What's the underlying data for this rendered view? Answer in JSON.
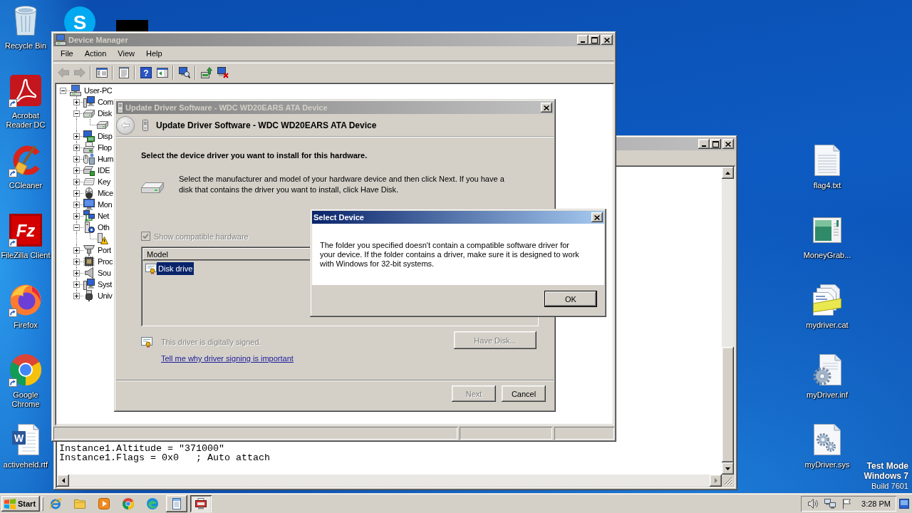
{
  "desktop": {
    "left_icons": [
      {
        "kind": "recycle-bin",
        "label": "Recycle Bin",
        "shortcut": false
      },
      {
        "kind": "pdf-reader",
        "label": "Acrobat Reader DC",
        "shortcut": true
      },
      {
        "kind": "cleaner",
        "label": "CCleaner",
        "shortcut": true
      },
      {
        "kind": "ftp-client",
        "label": "FileZilla Client",
        "shortcut": true,
        "logo_text": "Fz"
      },
      {
        "kind": "fox-browser",
        "label": "Firefox",
        "shortcut": true
      },
      {
        "kind": "chrome-browser",
        "label": "Google Chrome",
        "shortcut": true
      },
      {
        "kind": "word-document",
        "label": "activeheld.rtf",
        "shortcut": false,
        "logo_text": "W"
      }
    ],
    "covered_icon": {
      "kind": "chat-app",
      "logo_text": "S"
    },
    "right_icons": [
      {
        "kind": "text-file",
        "label": "flag4.txt",
        "shortcut": false
      },
      {
        "kind": "window-file",
        "label": "MoneyGrab...",
        "shortcut": false
      },
      {
        "kind": "catalog-file",
        "label": "mydriver.cat",
        "shortcut": false
      },
      {
        "kind": "settings-file",
        "label": "myDriver.inf",
        "shortcut": false
      },
      {
        "kind": "system-file",
        "label": "myDriver.sys",
        "shortcut": false
      }
    ],
    "test_mode": [
      "Test Mode",
      "Windows 7",
      "Build 7601"
    ]
  },
  "editor_window": {
    "active": false,
    "lines": [
      "Instance1.Altitude = \"371000\"",
      "Instance1.Flags = 0x0   ; Auto attach"
    ]
  },
  "device_manager": {
    "title": "Device Manager",
    "active": false,
    "menu": [
      "File",
      "Action",
      "View",
      "Help"
    ],
    "toolbar": [
      {
        "kind": "back",
        "disabled": true
      },
      {
        "kind": "forward",
        "disabled": true
      },
      {
        "kind": "separator"
      },
      {
        "kind": "console-tree",
        "disabled": false
      },
      {
        "kind": "separator"
      },
      {
        "kind": "properties",
        "disabled": false
      },
      {
        "kind": "separator"
      },
      {
        "kind": "help",
        "glyph": "?",
        "disabled": false
      },
      {
        "kind": "action-pane",
        "disabled": false
      },
      {
        "kind": "separator"
      },
      {
        "kind": "scan",
        "disabled": false
      },
      {
        "kind": "separator"
      },
      {
        "kind": "update-driver",
        "disabled": false
      },
      {
        "kind": "uninstall",
        "disabled": false
      }
    ],
    "tree": [
      {
        "label": "User-PC",
        "kind": "pc",
        "expanded": true,
        "children": [
          {
            "label": "Com",
            "kind": "computer",
            "expanded": false
          },
          {
            "label": "Disk",
            "kind": "drive",
            "expanded": true,
            "children": [
              {
                "kind": "drive"
              }
            ]
          },
          {
            "label": "Disp",
            "kind": "display",
            "expanded": false
          },
          {
            "label": "Flop",
            "kind": "floppy",
            "expanded": false
          },
          {
            "label": "Hum",
            "kind": "input-device",
            "expanded": false
          },
          {
            "label": "IDE",
            "kind": "controller",
            "expanded": false
          },
          {
            "label": "Key",
            "kind": "keyboard",
            "expanded": false
          },
          {
            "label": "Mice",
            "kind": "mouse",
            "expanded": false
          },
          {
            "label": "Mon",
            "kind": "monitor",
            "expanded": false
          },
          {
            "label": "Net",
            "kind": "network",
            "expanded": false
          },
          {
            "label": "Oth",
            "kind": "other",
            "expanded": true,
            "children": [
              {
                "kind": "unknown-device"
              }
            ]
          },
          {
            "label": "Port",
            "kind": "port",
            "expanded": false
          },
          {
            "label": "Proc",
            "kind": "processor",
            "expanded": false
          },
          {
            "label": "Sou",
            "kind": "speaker",
            "expanded": false
          },
          {
            "label": "Syst",
            "kind": "computer",
            "expanded": false
          },
          {
            "label": "Univ",
            "kind": "usb",
            "expanded": false
          }
        ]
      }
    ]
  },
  "update_driver": {
    "title": "Update Driver Software - WDC WD20EARS ATA Device",
    "active": false,
    "back_disabled": true,
    "header": "Update Driver Software - WDC WD20EARS ATA Device",
    "heading": "Select the device driver you want to install for this hardware.",
    "description": "Select the manufacturer and model of your hardware device and then click Next. If you have a disk that contains the driver you want to install, click Have Disk.",
    "compatible": {
      "label": "Show compatible hardware",
      "checked": true,
      "disabled": true
    },
    "list": {
      "column": "Model",
      "items": [
        {
          "label": "Disk drive",
          "selected": true
        }
      ]
    },
    "signature": {
      "text": "This driver is digitally signed.",
      "disabled": true
    },
    "link": "Tell me why driver signing is important",
    "have_disk": {
      "label": "Have Disk...",
      "disabled": true
    },
    "buttons": [
      {
        "label": "Next",
        "disabled": true
      },
      {
        "label": "Cancel",
        "disabled": false
      }
    ]
  },
  "select_device": {
    "title": "Select Device",
    "active": true,
    "message": "The folder you specified doesn't contain a compatible software driver for your device. If the folder contains a driver, make sure it is designed to work with Windows for 32-bit systems.",
    "buttons": [
      {
        "label": "OK",
        "default": true
      }
    ]
  },
  "taskbar": {
    "start": "Start",
    "quick_launch": [
      {
        "kind": "ie"
      },
      {
        "kind": "folder"
      },
      {
        "kind": "media-player"
      },
      {
        "kind": "chrome"
      },
      {
        "kind": "edge"
      }
    ],
    "tasks": [
      {
        "kind": "editor",
        "selected": false
      },
      {
        "kind": "device-manager",
        "selected": true
      }
    ],
    "tray": [
      {
        "kind": "volume"
      },
      {
        "kind": "network"
      },
      {
        "kind": "flag"
      }
    ],
    "clock": "3:28 PM"
  }
}
